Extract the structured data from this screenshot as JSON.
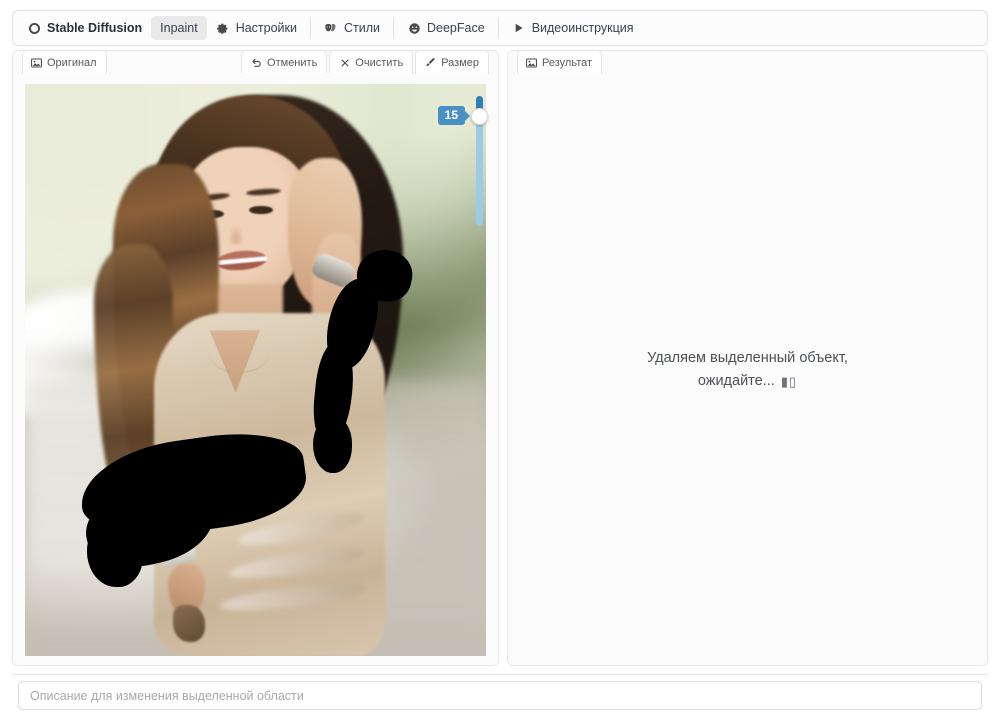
{
  "nav": {
    "items": [
      {
        "label": "Stable Diffusion",
        "icon": "circle-ring-icon",
        "name": "nav-brand-stable-diffusion",
        "active": false,
        "brand": true,
        "separator_after": false
      },
      {
        "label": "Inpaint",
        "icon": "",
        "name": "nav-tab-inpaint",
        "active": true,
        "brand": false,
        "separator_after": false
      },
      {
        "label": "Настройки",
        "icon": "gear-icon",
        "name": "nav-tab-settings",
        "active": false,
        "brand": false,
        "separator_after": true
      },
      {
        "label": "Стили",
        "icon": "theater-masks-icon",
        "name": "nav-tab-styles",
        "active": false,
        "brand": false,
        "separator_after": true
      },
      {
        "label": "DeepFace",
        "icon": "smiley-face-icon",
        "name": "nav-tab-deepface",
        "active": false,
        "brand": false,
        "separator_after": true
      },
      {
        "label": "Видеоинструкция",
        "icon": "play-triangle-icon",
        "name": "nav-tab-video-instruction",
        "active": false,
        "brand": false,
        "separator_after": false
      }
    ]
  },
  "left_panel": {
    "tab_label": "Оригинал",
    "tab_icon": "image-icon",
    "tools": [
      {
        "label": "Отменить",
        "icon": "undo-arrow-icon",
        "name": "undo-button"
      },
      {
        "label": "Очистить",
        "icon": "x-clear-icon",
        "name": "clear-button"
      },
      {
        "label": "Размер",
        "icon": "brush-icon",
        "name": "brush-size-button"
      }
    ],
    "brush_slider": {
      "value": "15",
      "min": "1",
      "max": "100"
    }
  },
  "right_panel": {
    "tab_label": "Результат",
    "tab_icon": "image-icon",
    "status_text": "Удаляем выделенный объект, ожидайте...",
    "spinner_glyph": "▮▯"
  },
  "prompt": {
    "placeholder": "Описание для изменения выделенной области",
    "value": ""
  },
  "colors": {
    "accent_blue": "#4a90c4",
    "slider_fill": "#2e7fb8",
    "slider_track": "#9ccbe8",
    "mask_black": "#000000",
    "panel_bg": "#fbfbfb",
    "border": "#e8e8e8"
  }
}
